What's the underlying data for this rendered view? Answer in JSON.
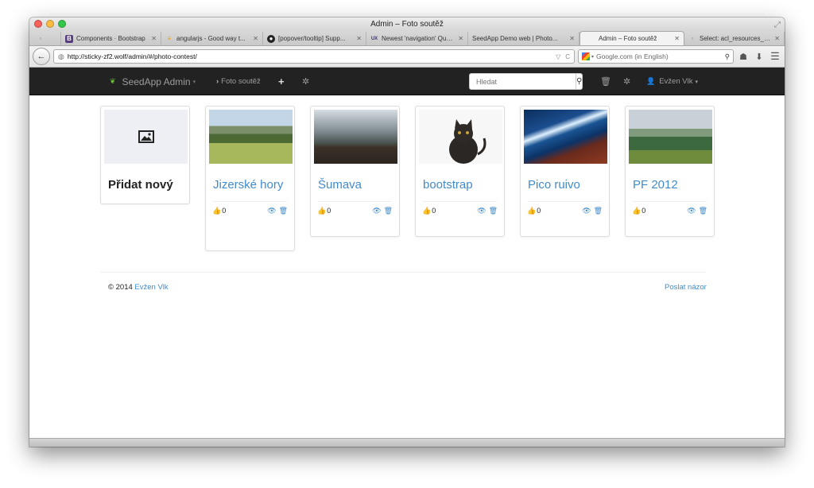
{
  "window": {
    "title": "Admin – Foto soutěž"
  },
  "tabs": [
    {
      "label": "",
      "icon": "document-icon"
    },
    {
      "label": "Components · Bootstrap",
      "icon": "bootstrap-icon"
    },
    {
      "label": "angularjs - Good way t...",
      "icon": "stackoverflow-icon"
    },
    {
      "label": "[popover/tooltip] Supp...",
      "icon": "github-icon"
    },
    {
      "label": "Newest 'navigation' Que...",
      "icon": "ux-icon"
    },
    {
      "label": "SeedApp Demo web | Photo...",
      "icon": "none"
    },
    {
      "label": "Admin – Foto soutěž",
      "icon": "none",
      "active": true
    },
    {
      "label": "Select: acl_resources_u...",
      "icon": "document-icon"
    }
  ],
  "browser": {
    "url": "http://sticky-zf2.wolf/admin/#/photo-contest/",
    "search_placeholder": "Google.com (in English)"
  },
  "appnav": {
    "brand": "SeedApp Admin",
    "breadcrumb": "Foto soutěž",
    "search_placeholder": "Hledat",
    "user": "Evžen Vlk"
  },
  "cards": [
    {
      "title": "Přidat nový",
      "type": "add"
    },
    {
      "title": "Jizerské hory",
      "likes": "0"
    },
    {
      "title": "Šumava",
      "likes": "0"
    },
    {
      "title": "bootstrap",
      "likes": "0"
    },
    {
      "title": "Pico ruivo",
      "likes": "0"
    },
    {
      "title": "PF 2012",
      "likes": "0"
    }
  ],
  "footer": {
    "copyright": "© 2014",
    "author": "Evžen Vlk",
    "feedback": "Poslat názor"
  },
  "colors": {
    "link": "#428bca",
    "navbar": "#222222",
    "leaf": "#6bbf3a"
  }
}
